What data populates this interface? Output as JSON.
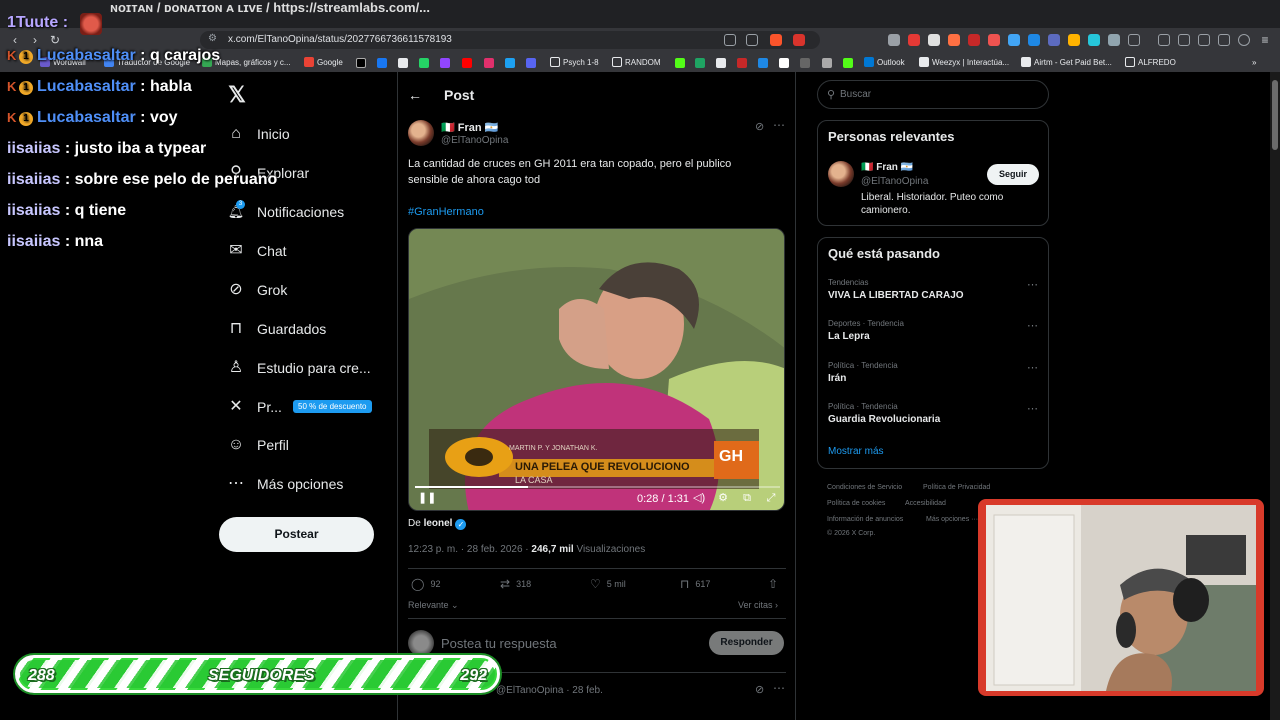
{
  "browser": {
    "url": "x.com/ElTanoOpina/status/2027766736611578193",
    "top_strip_text": "ɴᴏɪᴛᴀɴ / ᴅᴏɴᴀᴛɪᴏɴ ᴀ ʟɪᴠᴇ / https://streamlabs.com/...",
    "bookmarks": [
      {
        "label": "Wordwall",
        "color": "#6a5acd"
      },
      {
        "label": "Traductor de Google",
        "color": "#4285f4"
      },
      {
        "label": "Mapas, gráficos y c...",
        "color": "#34a853"
      },
      {
        "label": "Google",
        "color": "#ea4335"
      },
      {
        "label": "Psych 1-8",
        "color": "#e8eaed"
      },
      {
        "label": "RANDOM",
        "color": "#e8eaed"
      },
      {
        "label": "Outlook",
        "color": "#0078d4"
      },
      {
        "label": "Weezyx | Interactúa...",
        "color": "#e8eaed"
      },
      {
        "label": "Airtm - Get Paid Bet...",
        "color": "#e8eaed"
      },
      {
        "label": "ALFREDO",
        "color": "#e8eaed"
      }
    ]
  },
  "nav": {
    "items": [
      {
        "label": "Inicio",
        "icon": "home-icon",
        "glyph": "⌂"
      },
      {
        "label": "Explorar",
        "icon": "search-icon",
        "glyph": "⚲"
      },
      {
        "label": "Notificaciones",
        "icon": "bell-icon",
        "glyph": "🔔︎"
      },
      {
        "label": "Chat",
        "icon": "mail-icon",
        "glyph": "✉"
      },
      {
        "label": "Grok",
        "icon": "grok-icon",
        "glyph": "⊘"
      },
      {
        "label": "Guardados",
        "icon": "bookmark-icon",
        "glyph": "⊓"
      },
      {
        "label": "Estudio para cre...",
        "icon": "studio-icon",
        "glyph": "♙"
      },
      {
        "label": "Pr...",
        "icon": "x-premium-icon",
        "glyph": "✕"
      },
      {
        "label": "Perfil",
        "icon": "person-icon",
        "glyph": "☺"
      },
      {
        "label": "Más opciones",
        "icon": "more-icon",
        "glyph": "⋯"
      }
    ],
    "promo": "50 % de descuento",
    "post_button": "Postear",
    "notification_count": "3"
  },
  "post": {
    "header": "Post",
    "author_name": "🇮🇹 Fran 🇦🇷",
    "author_handle": "@ElTanoOpina",
    "text": "La cantidad de cruces en GH 2011 era tan copado, pero el publico\nsensible de ahora cago tod",
    "hashtag": "#GranHermano",
    "video": {
      "time": "0:28 / 1:31",
      "progress": 0.31,
      "banner_top": "MARTIN P. Y JONATHAN K.",
      "banner_main": "UNA PELEA QUE REVOLUCIONO",
      "banner_sub": "LA CASA",
      "logo": "GH"
    },
    "from_prefix": "De ",
    "from_user": "leonel",
    "timestamp": "12:23 p. m. · 28 feb. 2026 · ",
    "views": "246,7 mil",
    "views_label": " Visualizaciones",
    "stats": {
      "replies": "92",
      "reposts": "318",
      "likes": "5 mil",
      "bookmarks": "617"
    },
    "relevant": "Relevante ⌄",
    "see_quotes": "Ver citas ›",
    "reply_placeholder": "Postea tu respuesta",
    "reply_button": "Responder",
    "next_post_meta": "@ElTanoOpina · 28 feb."
  },
  "sidebar": {
    "search_placeholder": "Buscar",
    "relevant_title": "Personas relevantes",
    "relevant_name": "🇮🇹 Fran 🇦🇷",
    "relevant_handle": "@ElTanoOpina",
    "relevant_bio": "Liberal. Historiador. Puteo como camionero.",
    "follow": "Seguir",
    "trends_title": "Qué está pasando",
    "trends": [
      {
        "category": "Tendencias",
        "name": "VIVA LA LIBERTAD CARAJO"
      },
      {
        "category": "Deportes · Tendencia",
        "name": "La Lepra"
      },
      {
        "category": "Política · Tendencia",
        "name": "Irán"
      },
      {
        "category": "Política · Tendencia",
        "name": "Guardia Revolucionaria"
      }
    ],
    "show_more": "Mostrar más",
    "footer": [
      "Condiciones de Servicio",
      "Política de Privacidad",
      "Política de cookies",
      "Accesibilidad",
      "Información de anuncios",
      "Más opciones ···",
      "© 2026 X Corp."
    ]
  },
  "stream": {
    "top_user": "1Tuute :",
    "chat": [
      {
        "user": "Lucabasaltar",
        "msg": " : q carajos",
        "badged": true
      },
      {
        "user": "Lucabasaltar",
        "msg": " : habla",
        "badged": true
      },
      {
        "user": "Lucabasaltar",
        "msg": " : voy",
        "badged": true
      },
      {
        "user": "iisaiias",
        "msg": " : justo iba a typear",
        "badged": false
      },
      {
        "user": "iisaiias",
        "msg": " : sobre ese pelo de peruano",
        "badged": false
      },
      {
        "user": "iisaiias",
        "msg": " : q tiene",
        "badged": false
      },
      {
        "user": "iisaiias",
        "msg": " : nna",
        "badged": false
      }
    ],
    "goal": {
      "current": "288",
      "label": "SEGUIDORES",
      "target": "292"
    }
  },
  "colors": {
    "accent": "#1d9bf0",
    "background": "#000000",
    "goal_green": "#38d93c",
    "cam_border": "#d83a2a"
  }
}
